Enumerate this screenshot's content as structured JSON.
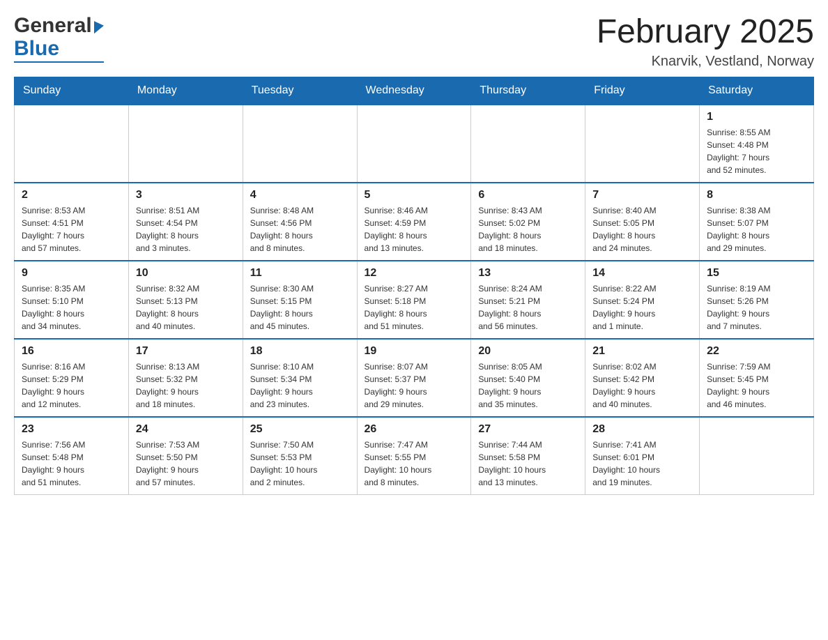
{
  "header": {
    "logo_general": "General",
    "logo_blue": "Blue",
    "month_title": "February 2025",
    "location": "Knarvik, Vestland, Norway"
  },
  "weekdays": [
    "Sunday",
    "Monday",
    "Tuesday",
    "Wednesday",
    "Thursday",
    "Friday",
    "Saturday"
  ],
  "weeks": [
    [
      {
        "day": "",
        "info": ""
      },
      {
        "day": "",
        "info": ""
      },
      {
        "day": "",
        "info": ""
      },
      {
        "day": "",
        "info": ""
      },
      {
        "day": "",
        "info": ""
      },
      {
        "day": "",
        "info": ""
      },
      {
        "day": "1",
        "info": "Sunrise: 8:55 AM\nSunset: 4:48 PM\nDaylight: 7 hours\nand 52 minutes."
      }
    ],
    [
      {
        "day": "2",
        "info": "Sunrise: 8:53 AM\nSunset: 4:51 PM\nDaylight: 7 hours\nand 57 minutes."
      },
      {
        "day": "3",
        "info": "Sunrise: 8:51 AM\nSunset: 4:54 PM\nDaylight: 8 hours\nand 3 minutes."
      },
      {
        "day": "4",
        "info": "Sunrise: 8:48 AM\nSunset: 4:56 PM\nDaylight: 8 hours\nand 8 minutes."
      },
      {
        "day": "5",
        "info": "Sunrise: 8:46 AM\nSunset: 4:59 PM\nDaylight: 8 hours\nand 13 minutes."
      },
      {
        "day": "6",
        "info": "Sunrise: 8:43 AM\nSunset: 5:02 PM\nDaylight: 8 hours\nand 18 minutes."
      },
      {
        "day": "7",
        "info": "Sunrise: 8:40 AM\nSunset: 5:05 PM\nDaylight: 8 hours\nand 24 minutes."
      },
      {
        "day": "8",
        "info": "Sunrise: 8:38 AM\nSunset: 5:07 PM\nDaylight: 8 hours\nand 29 minutes."
      }
    ],
    [
      {
        "day": "9",
        "info": "Sunrise: 8:35 AM\nSunset: 5:10 PM\nDaylight: 8 hours\nand 34 minutes."
      },
      {
        "day": "10",
        "info": "Sunrise: 8:32 AM\nSunset: 5:13 PM\nDaylight: 8 hours\nand 40 minutes."
      },
      {
        "day": "11",
        "info": "Sunrise: 8:30 AM\nSunset: 5:15 PM\nDaylight: 8 hours\nand 45 minutes."
      },
      {
        "day": "12",
        "info": "Sunrise: 8:27 AM\nSunset: 5:18 PM\nDaylight: 8 hours\nand 51 minutes."
      },
      {
        "day": "13",
        "info": "Sunrise: 8:24 AM\nSunset: 5:21 PM\nDaylight: 8 hours\nand 56 minutes."
      },
      {
        "day": "14",
        "info": "Sunrise: 8:22 AM\nSunset: 5:24 PM\nDaylight: 9 hours\nand 1 minute."
      },
      {
        "day": "15",
        "info": "Sunrise: 8:19 AM\nSunset: 5:26 PM\nDaylight: 9 hours\nand 7 minutes."
      }
    ],
    [
      {
        "day": "16",
        "info": "Sunrise: 8:16 AM\nSunset: 5:29 PM\nDaylight: 9 hours\nand 12 minutes."
      },
      {
        "day": "17",
        "info": "Sunrise: 8:13 AM\nSunset: 5:32 PM\nDaylight: 9 hours\nand 18 minutes."
      },
      {
        "day": "18",
        "info": "Sunrise: 8:10 AM\nSunset: 5:34 PM\nDaylight: 9 hours\nand 23 minutes."
      },
      {
        "day": "19",
        "info": "Sunrise: 8:07 AM\nSunset: 5:37 PM\nDaylight: 9 hours\nand 29 minutes."
      },
      {
        "day": "20",
        "info": "Sunrise: 8:05 AM\nSunset: 5:40 PM\nDaylight: 9 hours\nand 35 minutes."
      },
      {
        "day": "21",
        "info": "Sunrise: 8:02 AM\nSunset: 5:42 PM\nDaylight: 9 hours\nand 40 minutes."
      },
      {
        "day": "22",
        "info": "Sunrise: 7:59 AM\nSunset: 5:45 PM\nDaylight: 9 hours\nand 46 minutes."
      }
    ],
    [
      {
        "day": "23",
        "info": "Sunrise: 7:56 AM\nSunset: 5:48 PM\nDaylight: 9 hours\nand 51 minutes."
      },
      {
        "day": "24",
        "info": "Sunrise: 7:53 AM\nSunset: 5:50 PM\nDaylight: 9 hours\nand 57 minutes."
      },
      {
        "day": "25",
        "info": "Sunrise: 7:50 AM\nSunset: 5:53 PM\nDaylight: 10 hours\nand 2 minutes."
      },
      {
        "day": "26",
        "info": "Sunrise: 7:47 AM\nSunset: 5:55 PM\nDaylight: 10 hours\nand 8 minutes."
      },
      {
        "day": "27",
        "info": "Sunrise: 7:44 AM\nSunset: 5:58 PM\nDaylight: 10 hours\nand 13 minutes."
      },
      {
        "day": "28",
        "info": "Sunrise: 7:41 AM\nSunset: 6:01 PM\nDaylight: 10 hours\nand 19 minutes."
      },
      {
        "day": "",
        "info": ""
      }
    ]
  ]
}
